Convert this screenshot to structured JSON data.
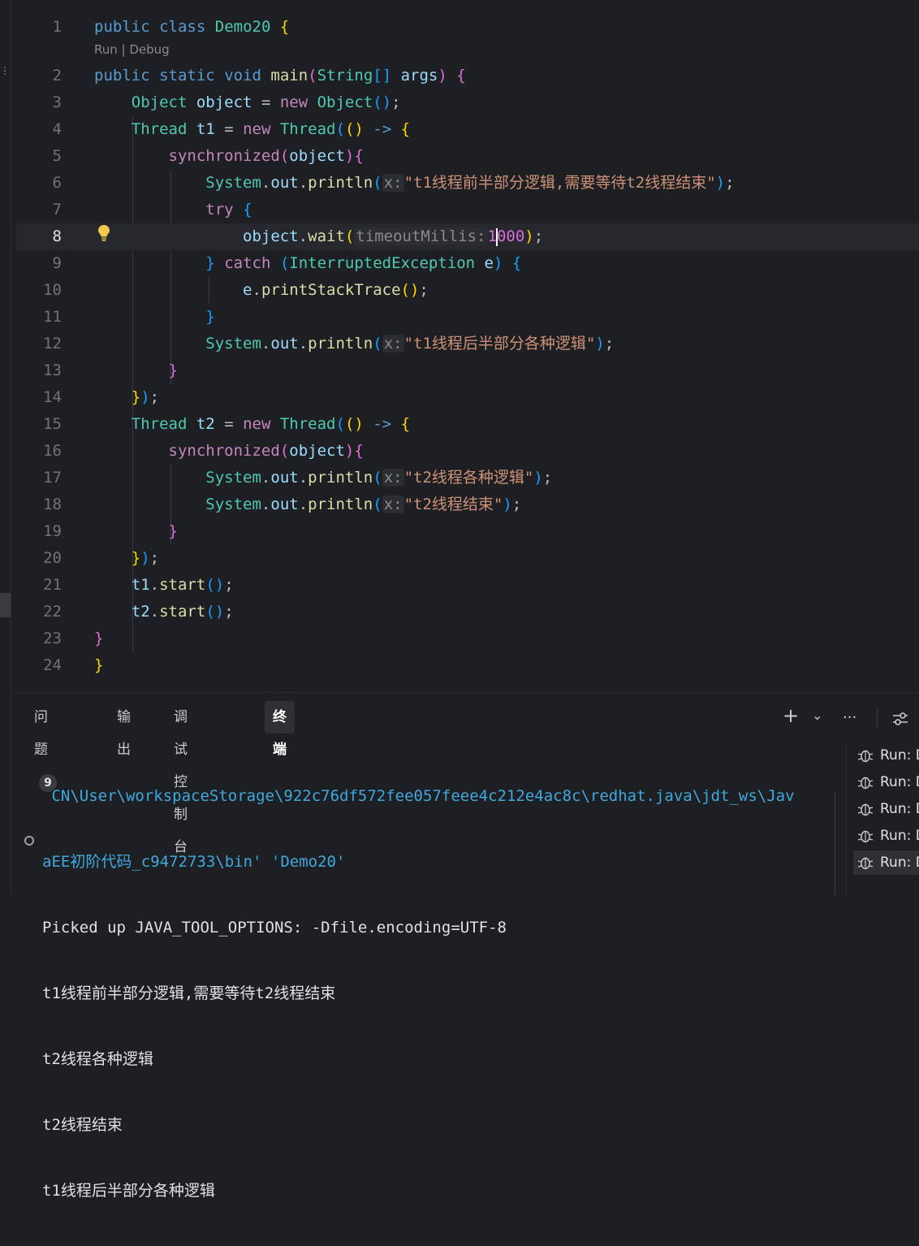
{
  "editor": {
    "code_lens": "Run | Debug",
    "lines": [
      {
        "num": "1"
      },
      {
        "num": "2"
      },
      {
        "num": "3"
      },
      {
        "num": "4"
      },
      {
        "num": "5"
      },
      {
        "num": "6"
      },
      {
        "num": "7"
      },
      {
        "num": "8"
      },
      {
        "num": "9"
      },
      {
        "num": "10"
      },
      {
        "num": "11"
      },
      {
        "num": "12"
      },
      {
        "num": "13"
      },
      {
        "num": "14"
      },
      {
        "num": "15"
      },
      {
        "num": "16"
      },
      {
        "num": "17"
      },
      {
        "num": "18"
      },
      {
        "num": "19"
      },
      {
        "num": "20"
      },
      {
        "num": "21"
      },
      {
        "num": "22"
      },
      {
        "num": "23"
      },
      {
        "num": "24"
      }
    ],
    "tokens": {
      "public": "public",
      "class": "class",
      "classname": "Demo20",
      "static": "static",
      "void": "void",
      "main": "main",
      "String": "String",
      "args": "args",
      "Object": "Object",
      "object": "object",
      "new": "new",
      "Thread": "Thread",
      "t1": "t1",
      "t2": "t2",
      "synchronized": "synchronized",
      "System": "System",
      "out": "out",
      "println": "println",
      "hint_x": "x:",
      "str1": "\"t1线程前半部分逻辑,需要等待t2线程结束\"",
      "try": "try",
      "wait": "wait",
      "hint_timeout": "timeoutMillis:",
      "num_a": "1",
      "num_b": "000",
      "catch": "catch",
      "InterruptedException": "InterruptedException",
      "e": "e",
      "printStackTrace": "printStackTrace",
      "str2": "\"t1线程后半部分各种逻辑\"",
      "str3": "\"t2线程各种逻辑\"",
      "str4": "\"t2线程结束\"",
      "start": "start"
    }
  },
  "panel": {
    "tabs": [
      {
        "label": "问题",
        "badge": "9"
      },
      {
        "label": "输出"
      },
      {
        "label": "调试控制台"
      },
      {
        "label": "终端"
      }
    ],
    "active_tab": "终端",
    "toolbar": {
      "add": "+",
      "dropdown": "⌄",
      "more": "···"
    },
    "terminal_lines": [
      " CN\\User\\workspaceStorage\\922c76df572fee057feee4c212e4ac8c\\redhat.java\\jdt_ws\\Jav",
      "aEE初阶代码_c9472733\\bin' 'Demo20'",
      "Picked up JAVA_TOOL_OPTIONS: -Dfile.encoding=UTF-8",
      "t1线程前半部分逻辑,需要等待t2线程结束",
      "t2线程各种逻辑",
      "t2线程结束",
      "t1线程后半部分各种逻辑"
    ],
    "sessions": [
      "Run: D",
      "Run: D",
      "Run: D",
      "Run: D",
      "Run: D"
    ]
  }
}
